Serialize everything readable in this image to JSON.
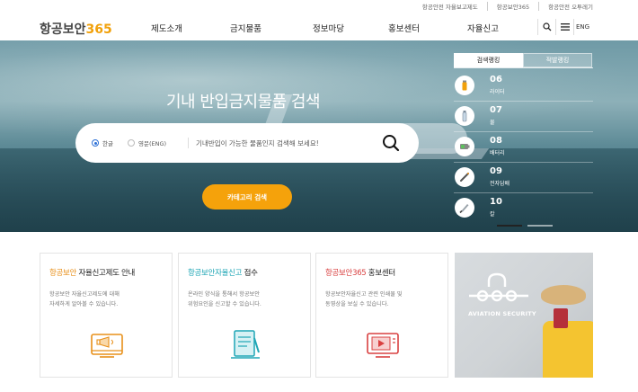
{
  "util": {
    "links": [
      "항공안전 자율보고제도",
      "항공보안365",
      "항공안전 오투레기"
    ]
  },
  "header": {
    "logo_text": "항공보안",
    "logo_num": "365",
    "nav": [
      "제도소개",
      "금지물품",
      "정보마당",
      "홍보센터",
      "자율신고"
    ],
    "lang_label": "ENG"
  },
  "hero": {
    "title": "기내 반입금지물품 검색",
    "radio_korean": "한글",
    "radio_english": "영문(ENG)",
    "search_placeholder": "기내반입이 가능한 물품인지 검색해 보세요!",
    "category_button": "카테고리 검색"
  },
  "ranking": {
    "tab_search": "검색랭킹",
    "tab_ban": "적발랭킹",
    "items": [
      {
        "no": "06",
        "name": "라이터",
        "icon": "lighter-icon"
      },
      {
        "no": "07",
        "name": "물",
        "icon": "water-bottle-icon"
      },
      {
        "no": "08",
        "name": "배터리",
        "icon": "battery-icon"
      },
      {
        "no": "09",
        "name": "전자담배",
        "icon": "e-cigarette-icon"
      },
      {
        "no": "10",
        "name": "칼",
        "icon": "knife-icon"
      }
    ],
    "page_active": 1
  },
  "cards": [
    {
      "highlight": "항공보안",
      "rest": " 자율신고제도 안내",
      "desc1": "항공보안 자율신고제도에 대해",
      "desc2": "자세하게 알아볼 수 있습니다.",
      "icon": "megaphone-icon"
    },
    {
      "highlight": "항공보안자율신고",
      "rest": " 접수",
      "desc1": "온라인 양식을 통해서 항공보안",
      "desc2": "위험요인을 신고할 수 있습니다.",
      "icon": "report-form-icon"
    },
    {
      "highlight": "항공보안365",
      "rest": " 홍보센터",
      "desc1": "항공보안자율신고 관련 인쇄물 및",
      "desc2": "동영상을 보실 수 있습니다.",
      "icon": "video-icon"
    }
  ],
  "promo": {
    "caption": "AVIATION SECURITY"
  },
  "colors": {
    "accent_orange": "#f5a20b",
    "accent_teal": "#1fa6b5",
    "accent_red": "#d94040",
    "active_radio": "#2b6fd6"
  }
}
